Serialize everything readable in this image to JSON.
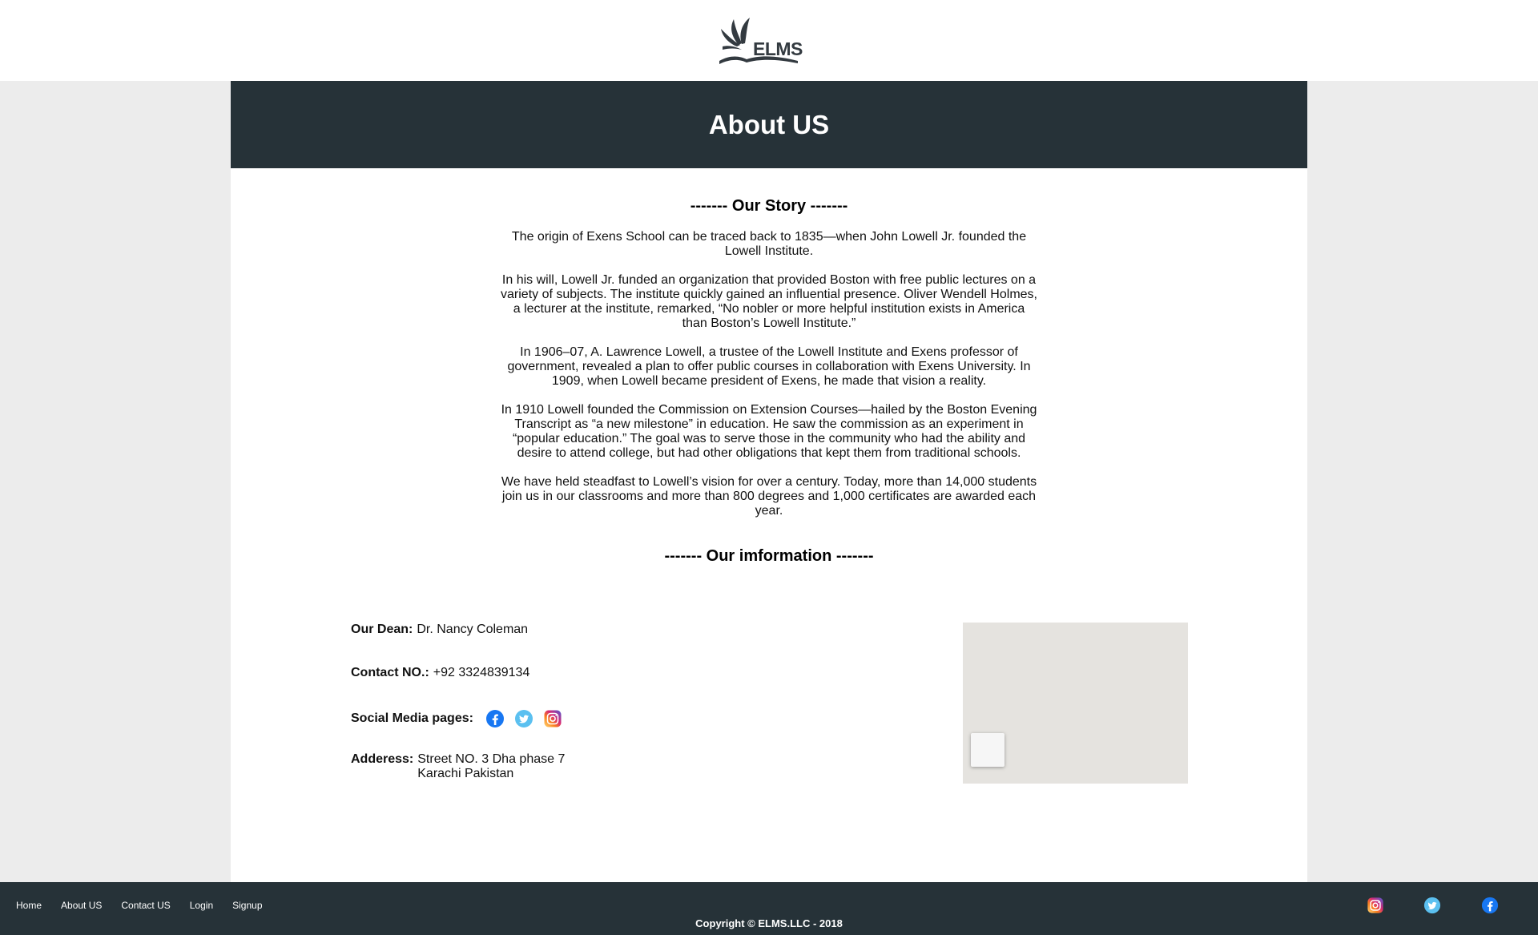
{
  "header": {
    "logo_text": "ELMS"
  },
  "banner": {
    "title": "About US"
  },
  "story": {
    "title": "------- Our Story -------",
    "paragraphs": [
      "The origin of Exens School can be traced back to 1835—when John Lowell Jr. founded the Lowell Institute.",
      "In his will, Lowell Jr. funded an organization that provided Boston with free public lectures on a variety of subjects. The institute quickly gained an influential presence. Oliver Wendell Holmes, a lecturer at the institute, remarked, “No nobler or more helpful institution exists in America than Boston’s Lowell Institute.”",
      "In 1906–07, A. Lawrence Lowell, a trustee of the Lowell Institute and Exens professor of government, revealed a plan to offer public courses in collaboration with Exens University. In 1909, when Lowell became president of Exens, he made that vision a reality.",
      "In 1910 Lowell founded the Commission on Extension Courses—hailed by the Boston Evening Transcript as “a new milestone” in education. He saw the commission as an experiment in “popular education.” The goal was to serve those in the community who had the ability and desire to attend college, but had other obligations that kept them from traditional schools.",
      "We have held steadfast to Lowell’s vision for over a century. Today, more than 14,000 students join us in our classrooms and more than 800 degrees and 1,000 certificates are awarded each year."
    ]
  },
  "information": {
    "title": "------- Our imformation -------",
    "dean_label": "Our Dean:",
    "dean_value": "Dr. Nancy Coleman",
    "contact_label": "Contact NO.:",
    "contact_value": "+92 3324839134",
    "social_label": "Social Media pages:",
    "social_icons": [
      "facebook-icon",
      "twitter-icon",
      "instagram-icon"
    ],
    "address_label": "Adderess:",
    "address_line1": "Street NO. 3 Dha phase 7",
    "address_line2": "Karachi Pakistan"
  },
  "footer": {
    "nav": [
      "Home",
      "About US",
      "Contact US",
      "Login",
      "Signup"
    ],
    "copyright": "Copyright © ELMS.LLC - 2018",
    "social_icons": [
      "instagram-icon",
      "twitter-icon",
      "facebook-icon"
    ]
  },
  "colors": {
    "dark": "#263238",
    "page_bg": "#ececec",
    "facebook": "#1877f2",
    "twitter": "#1da1f2",
    "map": "#e5e3df"
  }
}
